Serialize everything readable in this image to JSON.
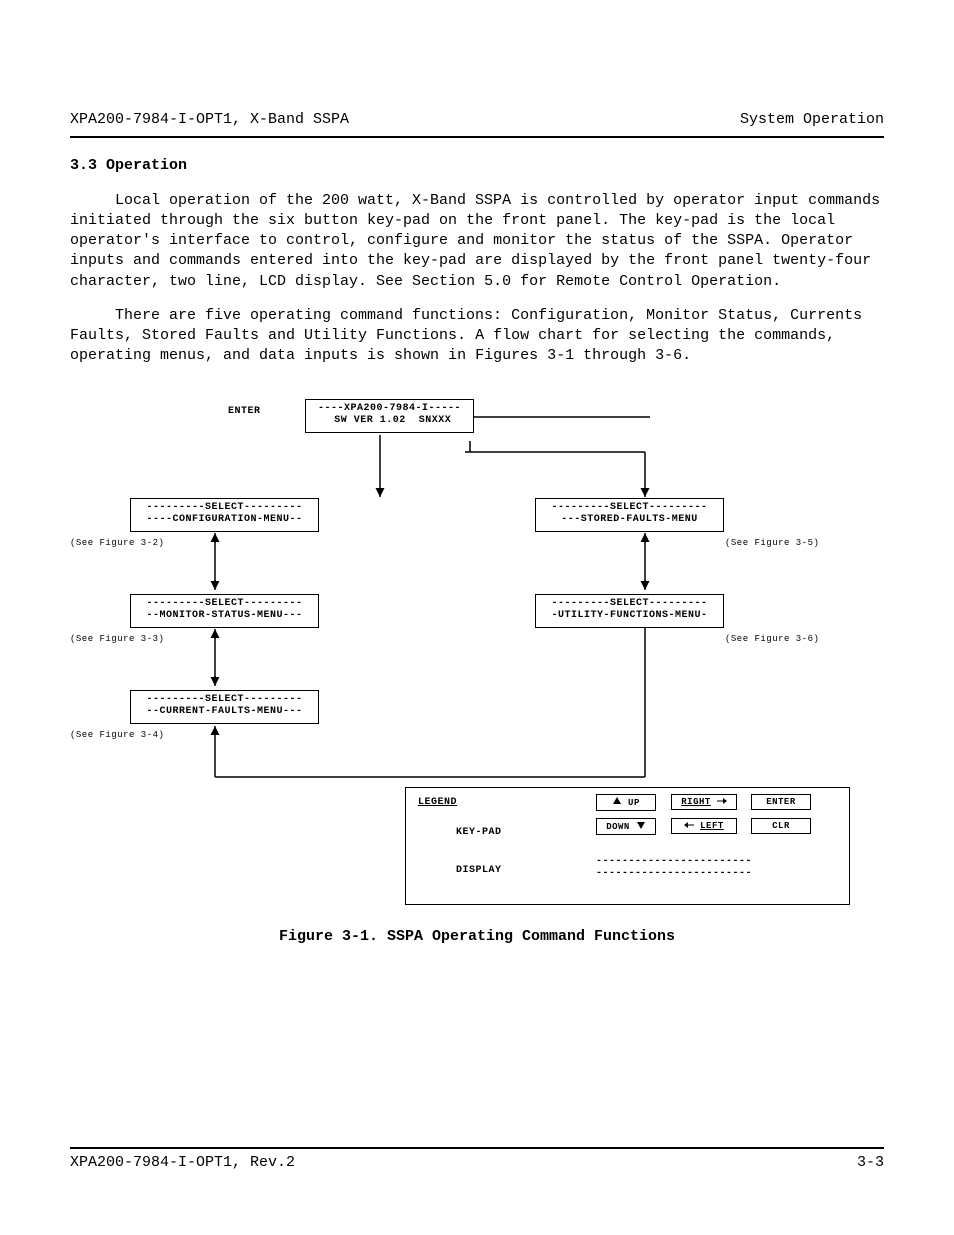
{
  "header": {
    "left": "XPA200-7984-I-OPT1, X-Band SSPA",
    "right": "System Operation"
  },
  "section": {
    "number_title": "3.3  Operation",
    "para1": "Local operation of the 200 watt, X-Band SSPA is controlled by operator input commands initiated through the six button key-pad on the front panel.  The key-pad is the local operator's interface to control, configure and monitor the status of the SSPA.  Operator inputs and commands entered into the key-pad are displayed by the front panel twenty-four character, two line, LCD display.  See Section 5.0 for Remote Control Operation.",
    "para2": "There are five operating command functions: Configuration, Monitor Status, Currents Faults, Stored Faults and Utility Functions.  A flow chart for selecting the commands, operating menus, and data inputs is shown in Figures 3-1 through 3-6."
  },
  "diagram": {
    "enter_label": "ENTER",
    "top_box": "----XPA200-7984-I-----\n SW VER 1.02  SNXXX",
    "left_boxes": [
      "---------SELECT---------\n----CONFIGURATION-MENU--",
      "---------SELECT---------\n--MONITOR-STATUS-MENU---",
      "---------SELECT---------\n--CURRENT-FAULTS-MENU---"
    ],
    "left_notes": [
      "(See Figure 3-2)",
      "(See Figure 3-3)",
      "(See Figure 3-4)"
    ],
    "right_boxes": [
      "---------SELECT---------\n---STORED-FAULTS-MENU",
      "---------SELECT---------\n-UTILITY-FUNCTIONS-MENU-"
    ],
    "right_notes": [
      "(See Figure 3-5)",
      "(See Figure 3-6)"
    ],
    "legend": {
      "title": "LEGEND",
      "keypad_label": "KEY-PAD",
      "display_label": "DISPLAY",
      "keys": {
        "up": "UP",
        "down": "DOWN",
        "right": "RIGHT",
        "left": "LEFT",
        "enter": "ENTER",
        "clr": "CLR"
      },
      "display_lines": "------------------------\n------------------------"
    }
  },
  "figure_caption": "Figure 3-1.  SSPA Operating Command Functions",
  "footer": {
    "left": "XPA200-7984-I-OPT1, Rev.2",
    "right": "3-3"
  }
}
